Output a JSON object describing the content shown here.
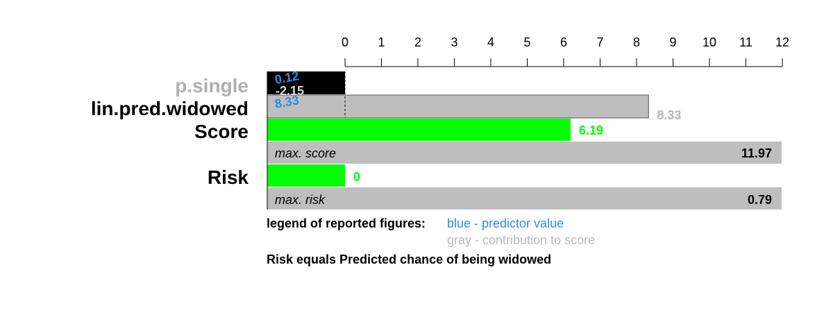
{
  "chart_data": {
    "type": "bar",
    "axis": {
      "min": 0,
      "max": 12,
      "ticks": [
        0,
        1,
        2,
        3,
        4,
        5,
        6,
        7,
        8,
        9,
        10,
        11,
        12
      ]
    },
    "predictors": [
      {
        "name": "p.single",
        "predictor_value": "0.12",
        "contribution": "-2.15",
        "contribution_value": -2.15,
        "label_color": "#b0b0b0"
      },
      {
        "name": "lin.pred.widowed",
        "predictor_value": "8.33",
        "contribution": "8.33",
        "contribution_value": 8.33,
        "label_color": "#000000"
      }
    ],
    "score": {
      "label": "Score",
      "value": 6.19,
      "value_text": "6.19",
      "max_label": "max. score",
      "max_value": 11.97,
      "max_text": "11.97"
    },
    "risk": {
      "label": "Risk",
      "value": 0,
      "value_text": "0",
      "max_label": "max. risk",
      "max_value": 0.79,
      "max_text": "0.79"
    }
  },
  "legend": {
    "title": "legend of reported figures:",
    "blue_text": "blue - predictor value",
    "gray_text": "gray - contribution to score"
  },
  "footnote": "Risk equals Predicted chance of being widowed",
  "colors": {
    "blue": "#2e8ce6",
    "gray_text": "#b8b8b8",
    "bar_gray": "#bebebe",
    "green": "#00ff00",
    "neg_bar": "#000000"
  }
}
